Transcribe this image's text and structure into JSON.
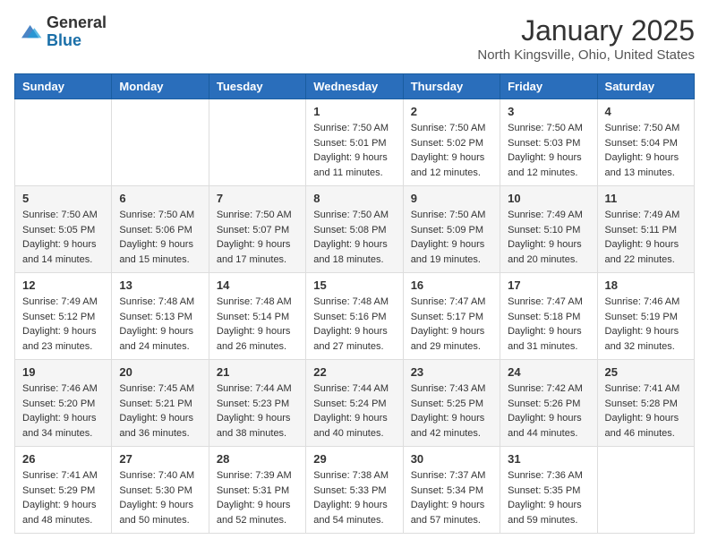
{
  "header": {
    "logo": {
      "line1": "General",
      "line2": "Blue"
    },
    "title": "January 2025",
    "subtitle": "North Kingsville, Ohio, United States"
  },
  "weekdays": [
    "Sunday",
    "Monday",
    "Tuesday",
    "Wednesday",
    "Thursday",
    "Friday",
    "Saturday"
  ],
  "weeks": [
    [
      {
        "day": "",
        "info": ""
      },
      {
        "day": "",
        "info": ""
      },
      {
        "day": "",
        "info": ""
      },
      {
        "day": "1",
        "info": "Sunrise: 7:50 AM\nSunset: 5:01 PM\nDaylight: 9 hours\nand 11 minutes."
      },
      {
        "day": "2",
        "info": "Sunrise: 7:50 AM\nSunset: 5:02 PM\nDaylight: 9 hours\nand 12 minutes."
      },
      {
        "day": "3",
        "info": "Sunrise: 7:50 AM\nSunset: 5:03 PM\nDaylight: 9 hours\nand 12 minutes."
      },
      {
        "day": "4",
        "info": "Sunrise: 7:50 AM\nSunset: 5:04 PM\nDaylight: 9 hours\nand 13 minutes."
      }
    ],
    [
      {
        "day": "5",
        "info": "Sunrise: 7:50 AM\nSunset: 5:05 PM\nDaylight: 9 hours\nand 14 minutes."
      },
      {
        "day": "6",
        "info": "Sunrise: 7:50 AM\nSunset: 5:06 PM\nDaylight: 9 hours\nand 15 minutes."
      },
      {
        "day": "7",
        "info": "Sunrise: 7:50 AM\nSunset: 5:07 PM\nDaylight: 9 hours\nand 17 minutes."
      },
      {
        "day": "8",
        "info": "Sunrise: 7:50 AM\nSunset: 5:08 PM\nDaylight: 9 hours\nand 18 minutes."
      },
      {
        "day": "9",
        "info": "Sunrise: 7:50 AM\nSunset: 5:09 PM\nDaylight: 9 hours\nand 19 minutes."
      },
      {
        "day": "10",
        "info": "Sunrise: 7:49 AM\nSunset: 5:10 PM\nDaylight: 9 hours\nand 20 minutes."
      },
      {
        "day": "11",
        "info": "Sunrise: 7:49 AM\nSunset: 5:11 PM\nDaylight: 9 hours\nand 22 minutes."
      }
    ],
    [
      {
        "day": "12",
        "info": "Sunrise: 7:49 AM\nSunset: 5:12 PM\nDaylight: 9 hours\nand 23 minutes."
      },
      {
        "day": "13",
        "info": "Sunrise: 7:48 AM\nSunset: 5:13 PM\nDaylight: 9 hours\nand 24 minutes."
      },
      {
        "day": "14",
        "info": "Sunrise: 7:48 AM\nSunset: 5:14 PM\nDaylight: 9 hours\nand 26 minutes."
      },
      {
        "day": "15",
        "info": "Sunrise: 7:48 AM\nSunset: 5:16 PM\nDaylight: 9 hours\nand 27 minutes."
      },
      {
        "day": "16",
        "info": "Sunrise: 7:47 AM\nSunset: 5:17 PM\nDaylight: 9 hours\nand 29 minutes."
      },
      {
        "day": "17",
        "info": "Sunrise: 7:47 AM\nSunset: 5:18 PM\nDaylight: 9 hours\nand 31 minutes."
      },
      {
        "day": "18",
        "info": "Sunrise: 7:46 AM\nSunset: 5:19 PM\nDaylight: 9 hours\nand 32 minutes."
      }
    ],
    [
      {
        "day": "19",
        "info": "Sunrise: 7:46 AM\nSunset: 5:20 PM\nDaylight: 9 hours\nand 34 minutes."
      },
      {
        "day": "20",
        "info": "Sunrise: 7:45 AM\nSunset: 5:21 PM\nDaylight: 9 hours\nand 36 minutes."
      },
      {
        "day": "21",
        "info": "Sunrise: 7:44 AM\nSunset: 5:23 PM\nDaylight: 9 hours\nand 38 minutes."
      },
      {
        "day": "22",
        "info": "Sunrise: 7:44 AM\nSunset: 5:24 PM\nDaylight: 9 hours\nand 40 minutes."
      },
      {
        "day": "23",
        "info": "Sunrise: 7:43 AM\nSunset: 5:25 PM\nDaylight: 9 hours\nand 42 minutes."
      },
      {
        "day": "24",
        "info": "Sunrise: 7:42 AM\nSunset: 5:26 PM\nDaylight: 9 hours\nand 44 minutes."
      },
      {
        "day": "25",
        "info": "Sunrise: 7:41 AM\nSunset: 5:28 PM\nDaylight: 9 hours\nand 46 minutes."
      }
    ],
    [
      {
        "day": "26",
        "info": "Sunrise: 7:41 AM\nSunset: 5:29 PM\nDaylight: 9 hours\nand 48 minutes."
      },
      {
        "day": "27",
        "info": "Sunrise: 7:40 AM\nSunset: 5:30 PM\nDaylight: 9 hours\nand 50 minutes."
      },
      {
        "day": "28",
        "info": "Sunrise: 7:39 AM\nSunset: 5:31 PM\nDaylight: 9 hours\nand 52 minutes."
      },
      {
        "day": "29",
        "info": "Sunrise: 7:38 AM\nSunset: 5:33 PM\nDaylight: 9 hours\nand 54 minutes."
      },
      {
        "day": "30",
        "info": "Sunrise: 7:37 AM\nSunset: 5:34 PM\nDaylight: 9 hours\nand 57 minutes."
      },
      {
        "day": "31",
        "info": "Sunrise: 7:36 AM\nSunset: 5:35 PM\nDaylight: 9 hours\nand 59 minutes."
      },
      {
        "day": "",
        "info": ""
      }
    ]
  ]
}
